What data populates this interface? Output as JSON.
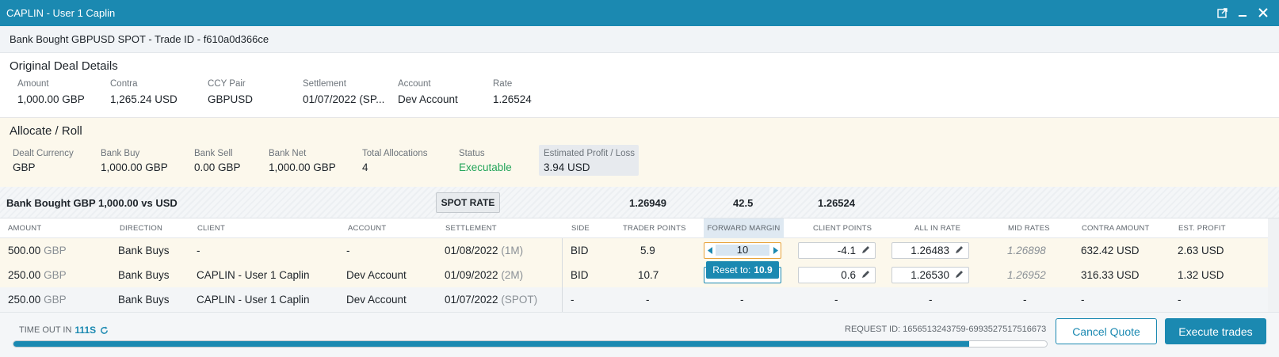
{
  "window": {
    "title": "CAPLIN - User 1 Caplin"
  },
  "trade": {
    "header": "Bank Bought GBPUSD SPOT - Trade ID - f610a0d366ce"
  },
  "original": {
    "title": "Original Deal Details",
    "fields": [
      {
        "label": "Amount",
        "value": "1,000.00 GBP"
      },
      {
        "label": "Contra",
        "value": "1,265.24 USD"
      },
      {
        "label": "CCY Pair",
        "value": "GBPUSD"
      },
      {
        "label": "Settlement",
        "value": "01/07/2022 (SP..."
      },
      {
        "label": "Account",
        "value": "Dev Account"
      },
      {
        "label": "Rate",
        "value": "1.26524"
      }
    ]
  },
  "allocate": {
    "title": "Allocate / Roll",
    "fields": [
      {
        "label": "Dealt Currency",
        "value": "GBP"
      },
      {
        "label": "Bank Buy",
        "value": "1,000.00 GBP"
      },
      {
        "label": "Bank Sell",
        "value": "0.00 GBP"
      },
      {
        "label": "Bank Net",
        "value": "1,000.00 GBP"
      },
      {
        "label": "Total Allocations",
        "value": "4"
      },
      {
        "label": "Status",
        "value": "Executable"
      },
      {
        "label": "Estimated Profit / Loss",
        "value": "3.94 USD"
      }
    ],
    "status_color": "#24a55a"
  },
  "summary": {
    "label": "Bank Bought GBP 1,000.00 vs USD",
    "spot_button": "SPOT RATE",
    "trader_points": "1.26949",
    "forward_margin": "42.5",
    "client_points": "1.26524"
  },
  "grid": {
    "headers": [
      "AMOUNT",
      "DIRECTION",
      "CLIENT",
      "ACCOUNT",
      "SETTLEMENT",
      "SIDE",
      "TRADER POINTS",
      "FORWARD MARGIN",
      "CLIENT POINTS",
      "ALL IN RATE",
      "MID RATES",
      "CONTRA AMOUNT",
      "EST. PROFIT"
    ],
    "rows": [
      {
        "amount": "500.00",
        "ccy": "GBP",
        "direction": "Bank Buys",
        "client": "-",
        "account": "-",
        "settlement": "01/08/2022",
        "tenor": "(1M)",
        "side": "BID",
        "trader_points": "5.9",
        "forward_margin": "10",
        "client_points": "-4.1",
        "all_in_rate": "1.26483",
        "mid_rate": "1.26898",
        "contra": "632.42 USD",
        "profit": "2.63 USD"
      },
      {
        "amount": "250.00",
        "ccy": "GBP",
        "direction": "Bank Buys",
        "client": "CAPLIN - User 1 Caplin",
        "account": "Dev Account",
        "settlement": "01/09/2022",
        "tenor": "(2M)",
        "side": "BID",
        "trader_points": "10.7",
        "forward_margin": "",
        "client_points": "0.6",
        "all_in_rate": "1.26530",
        "mid_rate": "1.26952",
        "contra": "316.33 USD",
        "profit": "1.32 USD"
      },
      {
        "amount": "250.00",
        "ccy": "GBP",
        "direction": "Bank Buys",
        "client": "CAPLIN - User 1 Caplin",
        "account": "Dev Account",
        "settlement": "01/07/2022",
        "tenor": "(SPOT)",
        "side": "-",
        "trader_points": "-",
        "forward_margin": "-",
        "client_points": "-",
        "all_in_rate": "-",
        "mid_rate": "-",
        "contra": "-",
        "profit": "-"
      }
    ],
    "tooltip_prefix": "Reset to:",
    "tooltip_value": "10.9"
  },
  "footer": {
    "timeout_label": "TIME OUT IN",
    "timeout_value": "111S",
    "request_id": "REQUEST ID: 1656513243759-6993527517516673",
    "progress_fraction": 0.925,
    "cancel": "Cancel Quote",
    "execute": "Execute trades"
  },
  "colors": {
    "accent": "#1b89b1",
    "highlight": "#e7a23a",
    "positive": "#24a55a"
  }
}
